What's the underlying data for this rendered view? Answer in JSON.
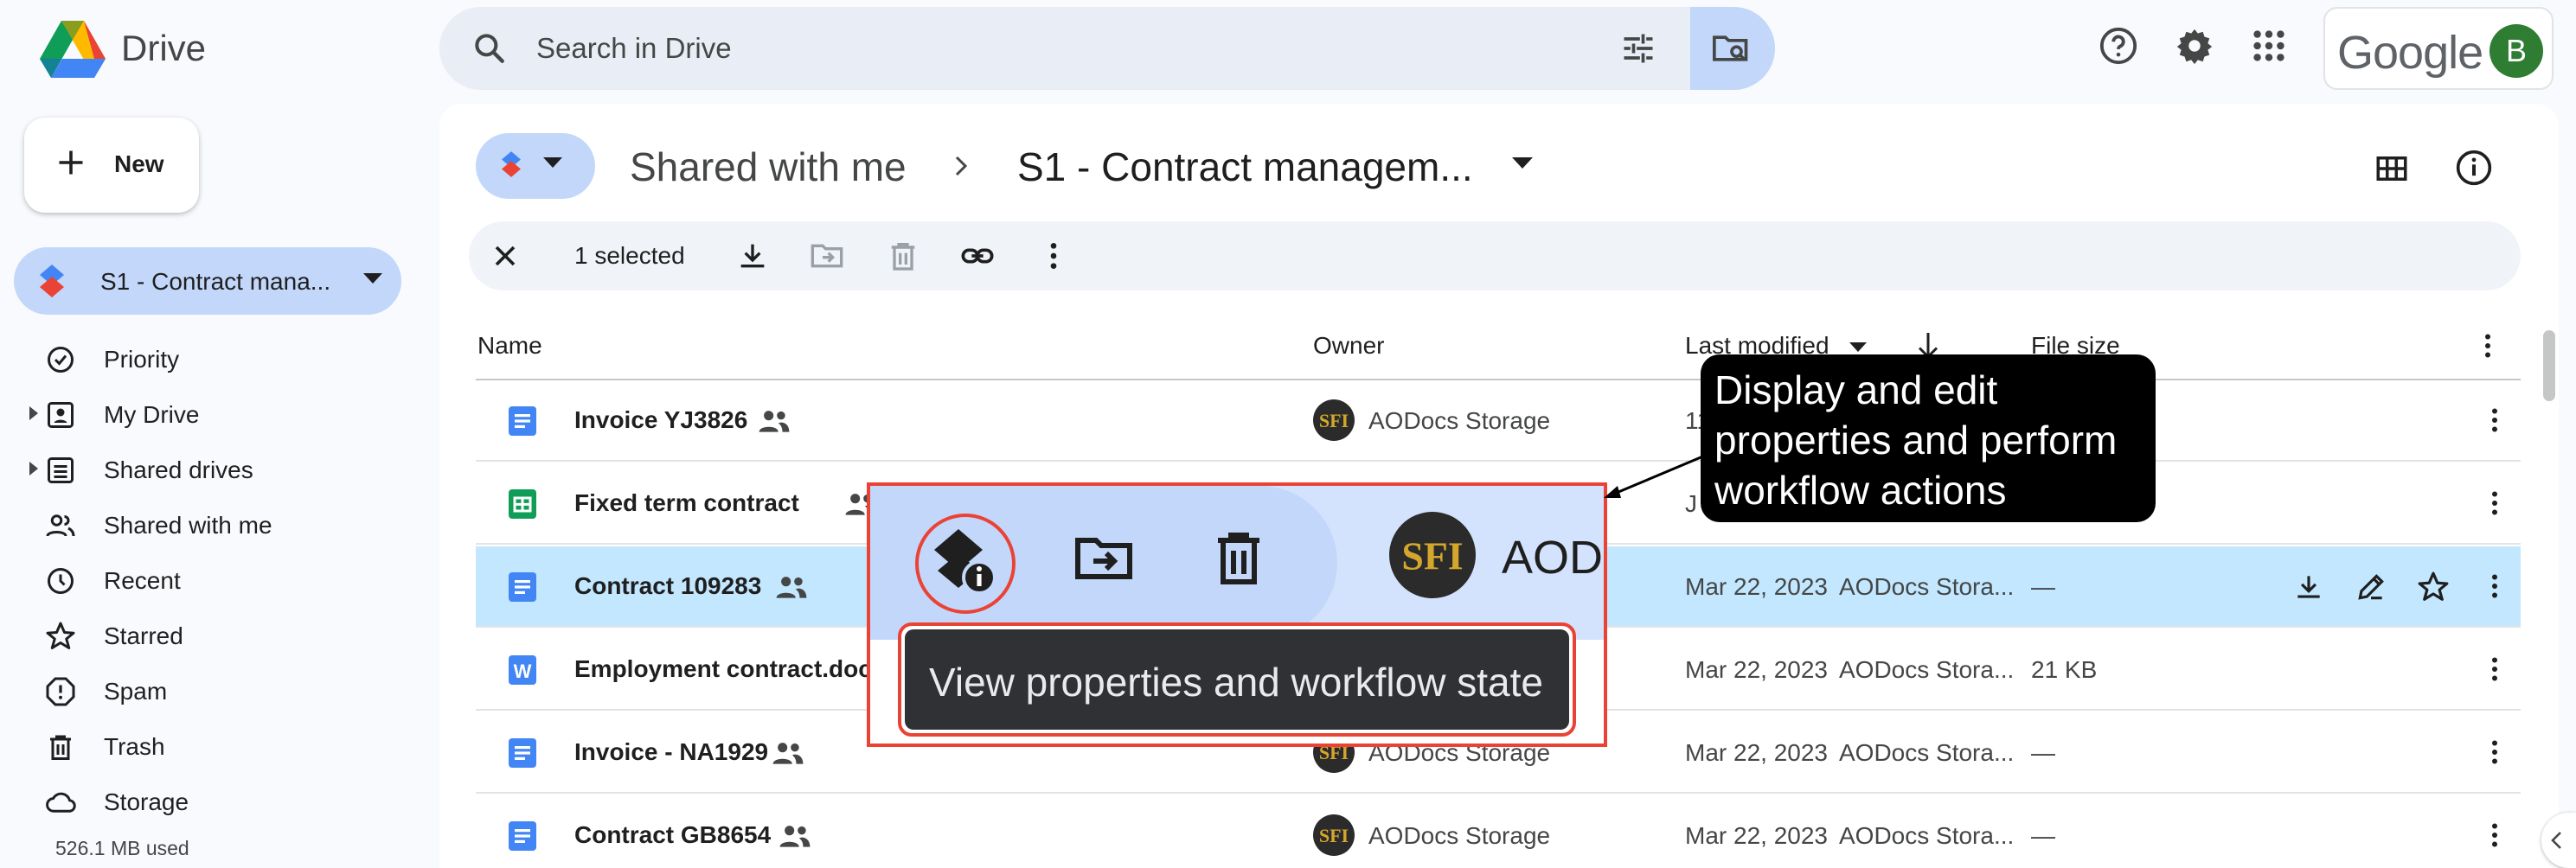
{
  "app": {
    "name": "Drive"
  },
  "search": {
    "placeholder": "Search in Drive"
  },
  "account": {
    "brand": "Google",
    "avatar_initial": "B",
    "avatar_color": "#2e7d32"
  },
  "sidebar": {
    "new_label": "New",
    "drive_selector": "S1 - Contract mana...",
    "items": [
      {
        "label": "Priority",
        "icon": "priority-icon"
      },
      {
        "label": "My Drive",
        "icon": "my-drive-icon"
      },
      {
        "label": "Shared drives",
        "icon": "shared-drives-icon"
      },
      {
        "label": "Shared with me",
        "icon": "shared-with-me-icon"
      },
      {
        "label": "Recent",
        "icon": "recent-icon"
      },
      {
        "label": "Starred",
        "icon": "starred-icon"
      },
      {
        "label": "Spam",
        "icon": "spam-icon"
      },
      {
        "label": "Trash",
        "icon": "trash-icon"
      },
      {
        "label": "Storage",
        "icon": "storage-icon"
      }
    ],
    "storage_used": "526.1 MB used"
  },
  "breadcrumb": {
    "parent": "Shared with me",
    "current": "S1 - Contract managem..."
  },
  "selection": {
    "label": "1 selected"
  },
  "table": {
    "headers": {
      "name": "Name",
      "owner": "Owner",
      "last_modified": "Last modified",
      "file_size": "File size"
    },
    "rows": [
      {
        "name": "Invoice YJ3826",
        "type": "doc",
        "shared": true,
        "owner": "AODocs Storage",
        "modified": "11",
        "modifier": "",
        "size": ""
      },
      {
        "name": "Fixed term contract",
        "type": "sheet",
        "shared": true,
        "owner": "",
        "modified": "J",
        "modifier": "",
        "size": ""
      },
      {
        "name": "Contract 109283",
        "type": "doc",
        "shared": true,
        "owner": "",
        "modified": "Mar 22, 2023",
        "modifier": "AODocs Stora...",
        "size": "—"
      },
      {
        "name": "Employment contract.doc",
        "type": "word",
        "shared": false,
        "owner": "",
        "modified": "Mar 22, 2023",
        "modifier": "AODocs Stora...",
        "size": "21 KB"
      },
      {
        "name": "Invoice - NA1929",
        "type": "doc",
        "shared": true,
        "owner": "AODocs Storage",
        "modified": "Mar 22, 2023",
        "modifier": "AODocs Stora...",
        "size": "—"
      },
      {
        "name": "Contract GB8654",
        "type": "doc",
        "shared": true,
        "owner": "AODocs Storage",
        "modified": "Mar 22, 2023",
        "modifier": "AODocs Stora...",
        "size": "—"
      }
    ]
  },
  "zoom": {
    "owner_peek": "AOD",
    "tooltip": "View properties and workflow state"
  },
  "callout": {
    "text": "Display and edit properties and perform workflow actions"
  },
  "colors": {
    "selected_row": "#c2e7ff",
    "highlight": "#ea4335",
    "doc_blue": "#4285f4",
    "sheet_green": "#0f9d58"
  }
}
